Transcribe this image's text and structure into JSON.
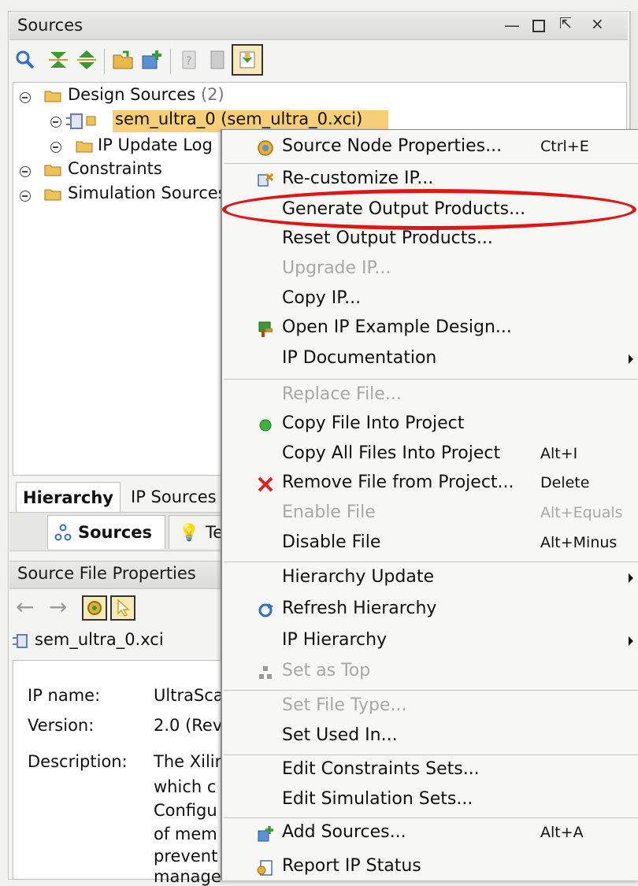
{
  "sources_panel": {
    "title": "Sources",
    "tree": {
      "design_sources_label": "Design Sources",
      "design_sources_count": "(2)",
      "selected_file": "sem_ultra_0 (sem_ultra_0.xci)",
      "ip_update_log": "IP Update Log",
      "constraints": "Constraints",
      "simulation_sources": "Simulation Sources"
    },
    "tabs": [
      "Hierarchy",
      "IP Sources"
    ],
    "subtabs": [
      "Sources",
      "Templates"
    ]
  },
  "properties_panel": {
    "title": "Source File Properties",
    "file_name": "sem_ultra_0.xci",
    "properties": [
      {
        "key": "IP name:",
        "value": "UltraScale Soft Error Mitigation"
      },
      {
        "key": "Version:",
        "value": "2.0 (Rev"
      },
      {
        "key": "Description:",
        "value": "The Xilinx"
      }
    ],
    "description_lines": [
      "which c",
      "Configu",
      "of mem",
      "prevent",
      "manage"
    ]
  },
  "context_menu": {
    "items": [
      {
        "label": "Source Node Properties...",
        "shortcut": "Ctrl+E",
        "icon": "properties-icon"
      },
      {
        "label": "Re-customize IP...",
        "icon": "customize-icon"
      },
      {
        "label": "Generate Output Products..."
      },
      {
        "label": "Reset Output Products..."
      },
      {
        "label": "Upgrade IP...",
        "disabled": true
      },
      {
        "label": "Copy IP..."
      },
      {
        "label": "Open IP Example Design...",
        "icon": "example-design-icon"
      },
      {
        "label": "IP Documentation",
        "submenu": true
      },
      {
        "label": "Replace File...",
        "disabled": true
      },
      {
        "label": "Copy File Into Project",
        "icon": "green-dot-icon"
      },
      {
        "label": "Copy All Files Into Project",
        "shortcut": "Alt+I"
      },
      {
        "label": "Remove File from Project...",
        "shortcut": "Delete",
        "icon": "red-x-icon"
      },
      {
        "label": "Enable File",
        "shortcut": "Alt+Equals",
        "disabled": true
      },
      {
        "label": "Disable File",
        "shortcut": "Alt+Minus"
      },
      {
        "label": "Hierarchy Update",
        "submenu": true
      },
      {
        "label": "Refresh Hierarchy",
        "icon": "refresh-icon"
      },
      {
        "label": "IP Hierarchy",
        "submenu": true
      },
      {
        "label": "Set as Top",
        "disabled": true,
        "icon": "hierarchy-icon"
      },
      {
        "label": "Set File Type...",
        "disabled": true
      },
      {
        "label": "Set Used In..."
      },
      {
        "label": "Edit Constraints Sets..."
      },
      {
        "label": "Edit Simulation Sets..."
      },
      {
        "label": "Add Sources...",
        "shortcut": "Alt+A",
        "icon": "add-sources-icon"
      },
      {
        "label": "Report IP Status",
        "icon": "report-icon"
      }
    ]
  },
  "colors": {
    "selection": "#f7cf78",
    "highlight_ellipse": "#e01515"
  }
}
